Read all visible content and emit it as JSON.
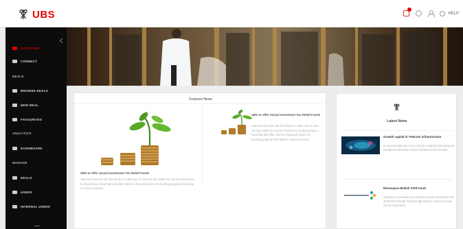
{
  "header": {
    "brand": "UBS",
    "help_label": "HELP"
  },
  "sidebar": {
    "items": [
      {
        "label": "ACTIVITIES",
        "active": true
      },
      {
        "label": "CONNECT"
      },
      {
        "section": "DEALS"
      },
      {
        "label": "BROWSE DEALS"
      },
      {
        "label": "NEW DEAL"
      },
      {
        "label": "FAVOURITES"
      },
      {
        "section": "ANALYTICS"
      },
      {
        "label": "DASHBOARD"
      },
      {
        "section": "MANAGE"
      },
      {
        "label": "DEALS"
      },
      {
        "label": "USERS"
      },
      {
        "label": "INTERNAL USERS"
      }
    ]
  },
  "featured": {
    "title": "Featured News",
    "main": {
      "title": "UBS to offer Social Investment Tax Relief Funds",
      "body": "UBS has become the first bank to make use of new UK tax reliefs for social investment, by launching a fund that will offer clients a financial return for backing projects that help to reduce poverty."
    },
    "side": {
      "title": "UBS to offer Social Investment Tax Relief Funds",
      "body": "UBS has become the first bank to make use of new UK tax reliefs for social investment, by launching a fund that will offer clients a financial return for backing projects that help to reduce poverty."
    }
  },
  "latest": {
    "title": "Latest News",
    "items": [
      {
        "title": "Growth capital in Telecom infrastructure",
        "body": "In concert with one of our clients, leading fundraising for European telecoms network infrastructure provider.",
        "thumb_icon": "network-visual"
      },
      {
        "title": "Resonance British SITR Fund",
        "body": "Helping to decrease UK poverty at scale around the UK all British through funding high-impact, revenue-driven social enterprises.",
        "thumb_logo": "resonance"
      }
    ]
  },
  "colors": {
    "brand_red": "#e60000",
    "sidebar_bg": "#0c0c0c",
    "page_bg": "#ededed"
  }
}
